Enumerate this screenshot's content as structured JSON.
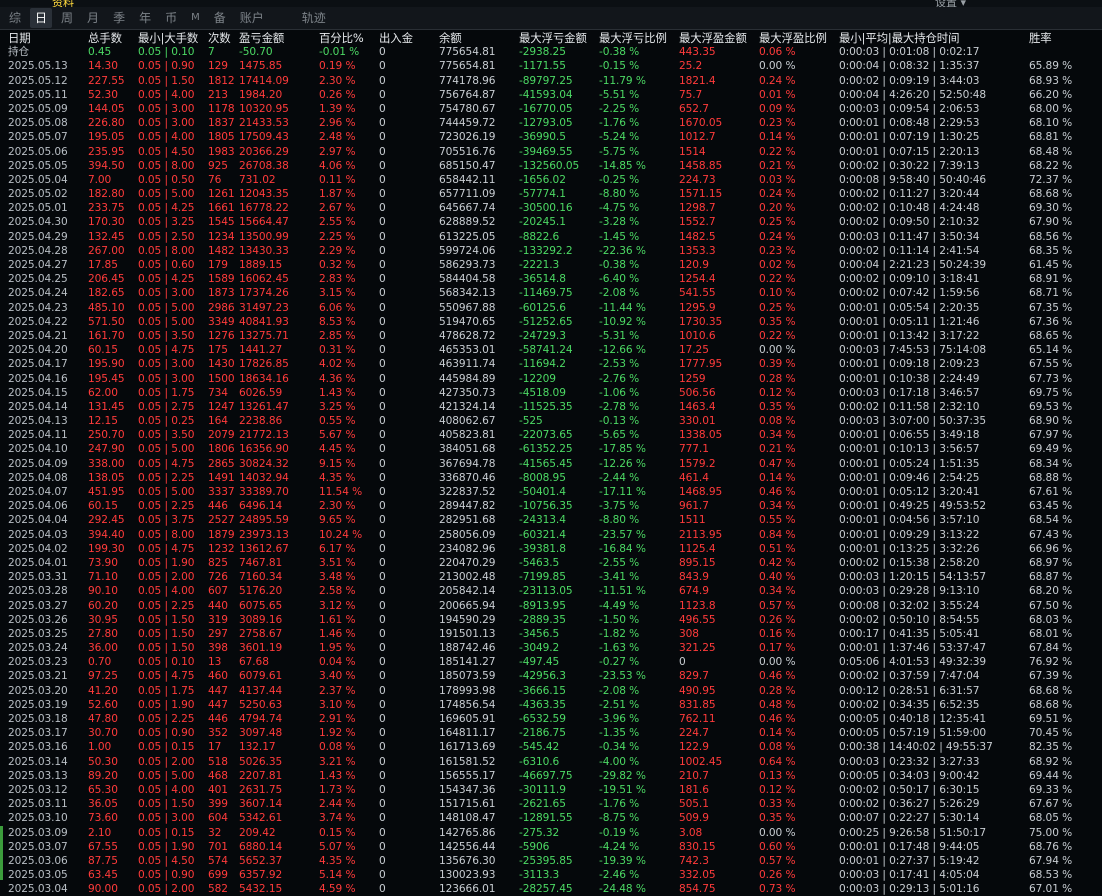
{
  "top": {
    "cut_left": "资料",
    "cut_right": "设置 ▾"
  },
  "tabs": [
    "综",
    "日",
    "周",
    "月",
    "季",
    "年",
    "币",
    "M",
    "备",
    "账户",
    "轨迹"
  ],
  "active_tab": "日",
  "headers": [
    "日期",
    "总手数",
    "最小|大手数",
    "次数",
    "盈亏金额",
    "百分比%",
    "出入金",
    "余额",
    "最大浮亏金额",
    "最大浮亏比例",
    "最大浮盈金额",
    "最大浮盈比例",
    "最小|平均|最大持仓时间",
    "胜率"
  ],
  "holding": {
    "label": "持仓",
    "vol": "0.45",
    "range": "0.05 | 0.10",
    "cnt": "7",
    "pnl": "-50.70",
    "pct": "-0.01 %",
    "io": "0",
    "bal": "775654.81",
    "mfl": "-2938.25",
    "mflr": "-0.38 %",
    "mfp": "443.35",
    "mfpr": "0.06 %",
    "hold": "0:00:03 | 0:01:08 | 0:02:17",
    "win": ""
  },
  "rows": [
    [
      "2025.05.13",
      "14.30",
      "0.05 | 0.90",
      "129",
      "1475.85",
      "0.19 %",
      "0",
      "775654.81",
      "-1171.55",
      "-0.15 %",
      "25.2",
      "0.00 %",
      "0:00:04 | 0:08:32 | 1:35:37",
      "65.89 %"
    ],
    [
      "2025.05.12",
      "227.55",
      "0.05 | 1.50",
      "1812",
      "17414.09",
      "2.30 %",
      "0",
      "774178.96",
      "-89797.25",
      "-11.79 %",
      "1821.4",
      "0.24 %",
      "0:00:02 | 0:09:19 | 3:44:03",
      "68.93 %"
    ],
    [
      "2025.05.11",
      "52.30",
      "0.05 | 4.00",
      "213",
      "1984.20",
      "0.26 %",
      "0",
      "756764.87",
      "-41593.04",
      "-5.51 %",
      "75.7",
      "0.01 %",
      "0:00:04 | 4:26:20 | 52:50:48",
      "66.20 %"
    ],
    [
      "2025.05.09",
      "144.05",
      "0.05 | 3.00",
      "1178",
      "10320.95",
      "1.39 %",
      "0",
      "754780.67",
      "-16770.05",
      "-2.25 %",
      "652.7",
      "0.09 %",
      "0:00:03 | 0:09:54 | 2:06:53",
      "68.00 %"
    ],
    [
      "2025.05.08",
      "226.80",
      "0.05 | 3.00",
      "1837",
      "21433.53",
      "2.96 %",
      "0",
      "744459.72",
      "-12793.05",
      "-1.76 %",
      "1670.05",
      "0.23 %",
      "0:00:01 | 0:08:48 | 2:29:53",
      "68.10 %"
    ],
    [
      "2025.05.07",
      "195.05",
      "0.05 | 4.00",
      "1805",
      "17509.43",
      "2.48 %",
      "0",
      "723026.19",
      "-36990.5",
      "-5.24 %",
      "1012.7",
      "0.14 %",
      "0:00:01 | 0:07:19 | 1:30:25",
      "68.81 %"
    ],
    [
      "2025.05.06",
      "235.95",
      "0.05 | 4.50",
      "1983",
      "20366.29",
      "2.97 %",
      "0",
      "705516.76",
      "-39469.55",
      "-5.75 %",
      "1514",
      "0.22 %",
      "0:00:01 | 0:07:15 | 2:20:13",
      "68.48 %"
    ],
    [
      "2025.05.05",
      "394.50",
      "0.05 | 8.00",
      "925",
      "26708.38",
      "4.06 %",
      "0",
      "685150.47",
      "-132560.05",
      "-14.85 %",
      "1458.85",
      "0.21 %",
      "0:00:02 | 0:30:22 | 7:39:13",
      "68.22 %"
    ],
    [
      "2025.05.04",
      "7.00",
      "0.05 | 0.50",
      "76",
      "731.02",
      "0.11 %",
      "0",
      "658442.11",
      "-1656.02",
      "-0.25 %",
      "224.73",
      "0.03 %",
      "0:00:08 | 9:58:40 | 50:40:46",
      "72.37 %"
    ],
    [
      "2025.05.02",
      "182.80",
      "0.05 | 5.00",
      "1261",
      "12043.35",
      "1.87 %",
      "0",
      "657711.09",
      "-57774.1",
      "-8.80 %",
      "1571.15",
      "0.24 %",
      "0:00:02 | 0:11:27 | 3:20:44",
      "68.68 %"
    ],
    [
      "2025.05.01",
      "233.75",
      "0.05 | 4.25",
      "1661",
      "16778.22",
      "2.67 %",
      "0",
      "645667.74",
      "-30500.16",
      "-4.75 %",
      "1298.7",
      "0.20 %",
      "0:00:02 | 0:10:48 | 4:24:48",
      "69.30 %"
    ],
    [
      "2025.04.30",
      "170.30",
      "0.05 | 3.25",
      "1545",
      "15664.47",
      "2.55 %",
      "0",
      "628889.52",
      "-20245.1",
      "-3.28 %",
      "1552.7",
      "0.25 %",
      "0:00:02 | 0:09:50 | 2:10:32",
      "67.90 %"
    ],
    [
      "2025.04.29",
      "132.45",
      "0.05 | 2.50",
      "1234",
      "13500.99",
      "2.25 %",
      "0",
      "613225.05",
      "-8822.6",
      "-1.45 %",
      "1482.5",
      "0.24 %",
      "0:00:03 | 0:11:47 | 3:50:34",
      "68.56 %"
    ],
    [
      "2025.04.28",
      "267.00",
      "0.05 | 8.00",
      "1482",
      "13430.33",
      "2.29 %",
      "0",
      "599724.06",
      "-133292.2",
      "-22.36 %",
      "1353.3",
      "0.23 %",
      "0:00:02 | 0:11:14 | 2:41:54",
      "68.35 %"
    ],
    [
      "2025.04.27",
      "17.85",
      "0.05 | 0.60",
      "179",
      "1889.15",
      "0.32 %",
      "0",
      "586293.73",
      "-2221.3",
      "-0.38 %",
      "120.9",
      "0.02 %",
      "0:00:04 | 2:21:23 | 50:24:39",
      "61.45 %"
    ],
    [
      "2025.04.25",
      "206.45",
      "0.05 | 4.25",
      "1589",
      "16062.45",
      "2.83 %",
      "0",
      "584404.58",
      "-36514.8",
      "-6.40 %",
      "1254.4",
      "0.22 %",
      "0:00:02 | 0:09:10 | 3:18:41",
      "68.91 %"
    ],
    [
      "2025.04.24",
      "182.65",
      "0.05 | 3.00",
      "1873",
      "17374.26",
      "3.15 %",
      "0",
      "568342.13",
      "-11469.75",
      "-2.08 %",
      "541.55",
      "0.10 %",
      "0:00:02 | 0:07:42 | 1:59:56",
      "68.71 %"
    ],
    [
      "2025.04.23",
      "485.10",
      "0.05 | 5.00",
      "2986",
      "31497.23",
      "6.06 %",
      "0",
      "550967.88",
      "-60125.6",
      "-11.44 %",
      "1295.9",
      "0.25 %",
      "0:00:01 | 0:05:54 | 2:20:35",
      "67.35 %"
    ],
    [
      "2025.04.22",
      "571.50",
      "0.05 | 5.00",
      "3349",
      "40841.93",
      "8.53 %",
      "0",
      "519470.65",
      "-51252.65",
      "-10.92 %",
      "1730.35",
      "0.35 %",
      "0:00:01 | 0:05:11 | 1:21:46",
      "67.36 %"
    ],
    [
      "2025.04.21",
      "161.70",
      "0.05 | 3.50",
      "1276",
      "13275.71",
      "2.85 %",
      "0",
      "478628.72",
      "-24729.3",
      "-5.31 %",
      "1010.6",
      "0.22 %",
      "0:00:01 | 0:13:42 | 3:17:22",
      "68.65 %"
    ],
    [
      "2025.04.20",
      "60.15",
      "0.05 | 4.75",
      "175",
      "1441.27",
      "0.31 %",
      "0",
      "465353.01",
      "-58741.24",
      "-12.66 %",
      "17.25",
      "0.00 %",
      "0:00:03 | 7:45:53 | 75:14:08",
      "65.14 %"
    ],
    [
      "2025.04.17",
      "195.90",
      "0.05 | 3.00",
      "1430",
      "17826.85",
      "4.02 %",
      "0",
      "463911.74",
      "-11694.2",
      "-2.53 %",
      "1777.95",
      "0.39 %",
      "0:00:01 | 0:09:18 | 2:09:23",
      "67.55 %"
    ],
    [
      "2025.04.16",
      "195.45",
      "0.05 | 3.00",
      "1500",
      "18634.16",
      "4.36 %",
      "0",
      "445984.89",
      "-12209",
      "-2.76 %",
      "1259",
      "0.28 %",
      "0:00:01 | 0:10:38 | 2:24:49",
      "67.73 %"
    ],
    [
      "2025.04.15",
      "62.00",
      "0.05 | 1.75",
      "734",
      "6026.59",
      "1.43 %",
      "0",
      "427350.73",
      "-4518.09",
      "-1.06 %",
      "506.56",
      "0.12 %",
      "0:00:03 | 0:17:18 | 3:46:57",
      "69.75 %"
    ],
    [
      "2025.04.14",
      "131.45",
      "0.05 | 2.75",
      "1247",
      "13261.47",
      "3.25 %",
      "0",
      "421324.14",
      "-11525.35",
      "-2.78 %",
      "1463.4",
      "0.35 %",
      "0:00:02 | 0:11:58 | 2:32:10",
      "69.53 %"
    ],
    [
      "2025.04.13",
      "12.15",
      "0.05 | 0.25",
      "164",
      "2238.86",
      "0.55 %",
      "0",
      "408062.67",
      "-525",
      "-0.13 %",
      "330.01",
      "0.08 %",
      "0:00:03 | 3:07:00 | 50:37:35",
      "68.90 %"
    ],
    [
      "2025.04.11",
      "250.70",
      "0.05 | 3.50",
      "2079",
      "21772.13",
      "5.67 %",
      "0",
      "405823.81",
      "-22073.65",
      "-5.65 %",
      "1338.05",
      "0.34 %",
      "0:00:01 | 0:06:55 | 3:49:18",
      "67.97 %"
    ],
    [
      "2025.04.10",
      "247.90",
      "0.05 | 5.00",
      "1806",
      "16356.90",
      "4.45 %",
      "0",
      "384051.68",
      "-61352.25",
      "-17.85 %",
      "777.1",
      "0.21 %",
      "0:00:01 | 0:10:13 | 3:56:57",
      "69.49 %"
    ],
    [
      "2025.04.09",
      "338.00",
      "0.05 | 4.75",
      "2865",
      "30824.32",
      "9.15 %",
      "0",
      "367694.78",
      "-41565.45",
      "-12.26 %",
      "1579.2",
      "0.47 %",
      "0:00:01 | 0:05:24 | 1:51:35",
      "68.34 %"
    ],
    [
      "2025.04.08",
      "138.05",
      "0.05 | 2.25",
      "1491",
      "14032.94",
      "4.35 %",
      "0",
      "336870.46",
      "-8008.95",
      "-2.44 %",
      "461.4",
      "0.14 %",
      "0:00:01 | 0:09:46 | 2:54:25",
      "68.88 %"
    ],
    [
      "2025.04.07",
      "451.95",
      "0.05 | 5.00",
      "3337",
      "33389.70",
      "11.54 %",
      "0",
      "322837.52",
      "-50401.4",
      "-17.11 %",
      "1468.95",
      "0.46 %",
      "0:00:01 | 0:05:12 | 3:20:41",
      "67.61 %"
    ],
    [
      "2025.04.06",
      "60.15",
      "0.05 | 2.25",
      "446",
      "6496.14",
      "2.30 %",
      "0",
      "289447.82",
      "-10756.35",
      "-3.75 %",
      "961.7",
      "0.34 %",
      "0:00:01 | 0:49:25 | 49:53:52",
      "63.45 %"
    ],
    [
      "2025.04.04",
      "292.45",
      "0.05 | 3.75",
      "2527",
      "24895.59",
      "9.65 %",
      "0",
      "282951.68",
      "-24313.4",
      "-8.80 %",
      "1511",
      "0.55 %",
      "0:00:01 | 0:04:56 | 3:57:10",
      "68.54 %"
    ],
    [
      "2025.04.03",
      "394.40",
      "0.05 | 8.00",
      "1879",
      "23973.13",
      "10.24 %",
      "0",
      "258056.09",
      "-60321.4",
      "-23.57 %",
      "2113.95",
      "0.84 %",
      "0:00:01 | 0:09:29 | 3:13:22",
      "67.43 %"
    ],
    [
      "2025.04.02",
      "199.30",
      "0.05 | 4.75",
      "1232",
      "13612.67",
      "6.17 %",
      "0",
      "234082.96",
      "-39381.8",
      "-16.84 %",
      "1125.4",
      "0.51 %",
      "0:00:01 | 0:13:25 | 3:32:26",
      "66.96 %"
    ],
    [
      "2025.04.01",
      "73.90",
      "0.05 | 1.90",
      "825",
      "7467.81",
      "3.51 %",
      "0",
      "220470.29",
      "-5463.5",
      "-2.55 %",
      "895.15",
      "0.42 %",
      "0:00:02 | 0:15:38 | 2:58:20",
      "68.97 %"
    ],
    [
      "2025.03.31",
      "71.10",
      "0.05 | 2.00",
      "726",
      "7160.34",
      "3.48 %",
      "0",
      "213002.48",
      "-7199.85",
      "-3.41 %",
      "843.9",
      "0.40 %",
      "0:00:03 | 1:20:15 | 54:13:57",
      "68.87 %"
    ],
    [
      "2025.03.28",
      "90.10",
      "0.05 | 4.00",
      "607",
      "5176.20",
      "2.58 %",
      "0",
      "205842.14",
      "-23113.05",
      "-11.51 %",
      "674.9",
      "0.34 %",
      "0:00:03 | 0:29:28 | 9:13:10",
      "68.20 %"
    ],
    [
      "2025.03.27",
      "60.20",
      "0.05 | 2.25",
      "440",
      "6075.65",
      "3.12 %",
      "0",
      "200665.94",
      "-8913.95",
      "-4.49 %",
      "1123.8",
      "0.57 %",
      "0:00:08 | 0:32:02 | 3:55:24",
      "67.50 %"
    ],
    [
      "2025.03.26",
      "30.95",
      "0.05 | 1.50",
      "319",
      "3089.16",
      "1.61 %",
      "0",
      "194590.29",
      "-2889.35",
      "-1.50 %",
      "496.55",
      "0.26 %",
      "0:00:02 | 0:50:10 | 8:54:55",
      "68.03 %"
    ],
    [
      "2025.03.25",
      "27.80",
      "0.05 | 1.50",
      "297",
      "2758.67",
      "1.46 %",
      "0",
      "191501.13",
      "-3456.5",
      "-1.82 %",
      "308",
      "0.16 %",
      "0:00:17 | 0:41:35 | 5:05:41",
      "68.01 %"
    ],
    [
      "2025.03.24",
      "36.00",
      "0.05 | 1.50",
      "398",
      "3601.19",
      "1.95 %",
      "0",
      "188742.46",
      "-3049.2",
      "-1.63 %",
      "321.25",
      "0.17 %",
      "0:00:01 | 1:37:46 | 53:37:47",
      "67.84 %"
    ],
    [
      "2025.03.23",
      "0.70",
      "0.05 | 0.10",
      "13",
      "67.68",
      "0.04 %",
      "0",
      "185141.27",
      "-497.45",
      "-0.27 %",
      "0",
      "0.00 %",
      "0:05:06 | 4:01:53 | 49:32:39",
      "76.92 %"
    ],
    [
      "2025.03.21",
      "97.25",
      "0.05 | 4.75",
      "460",
      "6079.61",
      "3.40 %",
      "0",
      "185073.59",
      "-42956.3",
      "-23.53 %",
      "829.7",
      "0.46 %",
      "0:00:02 | 0:37:59 | 7:47:04",
      "67.39 %"
    ],
    [
      "2025.03.20",
      "41.20",
      "0.05 | 1.75",
      "447",
      "4137.44",
      "2.37 %",
      "0",
      "178993.98",
      "-3666.15",
      "-2.08 %",
      "490.95",
      "0.28 %",
      "0:00:12 | 0:28:51 | 6:31:57",
      "68.68 %"
    ],
    [
      "2025.03.19",
      "52.60",
      "0.05 | 1.90",
      "447",
      "5250.63",
      "3.10 %",
      "0",
      "174856.54",
      "-4363.35",
      "-2.51 %",
      "831.85",
      "0.48 %",
      "0:00:02 | 0:34:35 | 6:52:35",
      "68.68 %"
    ],
    [
      "2025.03.18",
      "47.80",
      "0.05 | 2.25",
      "446",
      "4794.74",
      "2.91 %",
      "0",
      "169605.91",
      "-6532.59",
      "-3.96 %",
      "762.11",
      "0.46 %",
      "0:00:05 | 0:40:18 | 12:35:41",
      "69.51 %"
    ],
    [
      "2025.03.17",
      "30.70",
      "0.05 | 0.90",
      "352",
      "3097.48",
      "1.92 %",
      "0",
      "164811.17",
      "-2186.75",
      "-1.35 %",
      "224.7",
      "0.14 %",
      "0:00:05 | 0:57:19 | 51:59:00",
      "70.45 %"
    ],
    [
      "2025.03.16",
      "1.00",
      "0.05 | 0.15",
      "17",
      "132.17",
      "0.08 %",
      "0",
      "161713.69",
      "-545.42",
      "-0.34 %",
      "122.9",
      "0.08 %",
      "0:00:38 | 14:40:02 | 49:55:37",
      "82.35 %"
    ],
    [
      "2025.03.14",
      "50.30",
      "0.05 | 2.00",
      "518",
      "5026.35",
      "3.21 %",
      "0",
      "161581.52",
      "-6310.6",
      "-4.00 %",
      "1002.45",
      "0.64 %",
      "0:00:03 | 0:23:32 | 3:27:33",
      "68.92 %"
    ],
    [
      "2025.03.13",
      "89.20",
      "0.05 | 5.00",
      "468",
      "2207.81",
      "1.43 %",
      "0",
      "156555.17",
      "-46697.75",
      "-29.82 %",
      "210.7",
      "0.13 %",
      "0:00:05 | 0:34:03 | 9:00:42",
      "69.44 %"
    ],
    [
      "2025.03.12",
      "65.30",
      "0.05 | 4.00",
      "401",
      "2631.75",
      "1.73 %",
      "0",
      "154347.36",
      "-30111.9",
      "-19.51 %",
      "181.6",
      "0.12 %",
      "0:00:02 | 0:50:17 | 6:30:15",
      "69.33 %"
    ],
    [
      "2025.03.11",
      "36.05",
      "0.05 | 1.50",
      "399",
      "3607.14",
      "2.44 %",
      "0",
      "151715.61",
      "-2621.65",
      "-1.76 %",
      "505.1",
      "0.33 %",
      "0:00:02 | 0:36:27 | 5:26:29",
      "67.67 %"
    ],
    [
      "2025.03.10",
      "73.60",
      "0.05 | 3.00",
      "604",
      "5342.61",
      "3.74 %",
      "0",
      "148108.47",
      "-12891.55",
      "-8.75 %",
      "509.9",
      "0.35 %",
      "0:00:07 | 0:22:27 | 5:30:14",
      "68.05 %"
    ],
    [
      "2025.03.09",
      "2.10",
      "0.05 | 0.15",
      "32",
      "209.42",
      "0.15 %",
      "0",
      "142765.86",
      "-275.32",
      "-0.19 %",
      "3.08",
      "0.00 %",
      "0:00:25 | 9:26:58 | 51:50:17",
      "75.00 %"
    ],
    [
      "2025.03.07",
      "67.55",
      "0.05 | 1.90",
      "701",
      "6880.14",
      "5.07 %",
      "0",
      "142556.44",
      "-5906",
      "-4.24 %",
      "830.15",
      "0.60 %",
      "0:00:01 | 0:17:48 | 9:44:05",
      "68.76 %"
    ],
    [
      "2025.03.06",
      "87.75",
      "0.05 | 4.50",
      "574",
      "5652.37",
      "4.35 %",
      "0",
      "135676.30",
      "-25395.85",
      "-19.39 %",
      "742.3",
      "0.57 %",
      "0:00:01 | 0:27:37 | 5:19:42",
      "67.94 %"
    ],
    [
      "2025.03.05",
      "63.45",
      "0.05 | 0.90",
      "699",
      "6357.92",
      "5.14 %",
      "0",
      "130023.93",
      "-3113.3",
      "-2.46 %",
      "332.05",
      "0.26 %",
      "0:00:03 | 0:17:41 | 4:05:04",
      "68.53 %"
    ],
    [
      "2025.03.04",
      "90.00",
      "0.05 | 2.00",
      "582",
      "5432.15",
      "4.59 %",
      "0",
      "123666.01",
      "-28257.45",
      "-24.48 %",
      "854.75",
      "0.73 %",
      "0:00:03 | 0:29:13 | 5:01:16",
      "67.01 %"
    ]
  ]
}
